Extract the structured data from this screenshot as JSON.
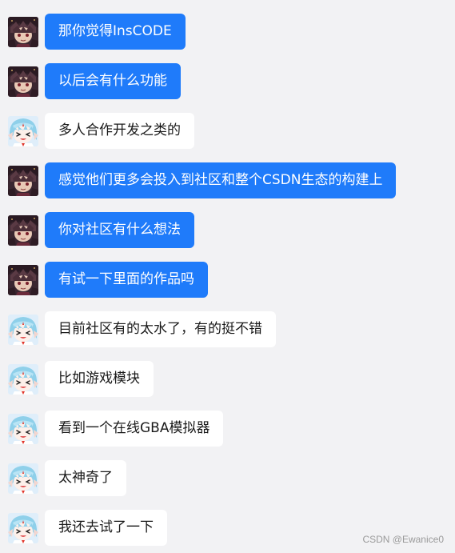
{
  "conversation": {
    "messages": [
      {
        "sender": "dark",
        "text": "那你觉得InsCODE"
      },
      {
        "sender": "dark",
        "text": "以后会有什么功能"
      },
      {
        "sender": "light",
        "text": "多人合作开发之类的"
      },
      {
        "sender": "dark",
        "text": "感觉他们更多会投入到社区和整个CSDN生态的构建上"
      },
      {
        "sender": "dark",
        "text": "你对社区有什么想法"
      },
      {
        "sender": "dark",
        "text": "有试一下里面的作品吗"
      },
      {
        "sender": "light",
        "text": "目前社区有的太水了，有的挺不错"
      },
      {
        "sender": "light",
        "text": "比如游戏模块"
      },
      {
        "sender": "light",
        "text": "看到一个在线GBA模拟器"
      },
      {
        "sender": "light",
        "text": "太神奇了"
      },
      {
        "sender": "light",
        "text": "我还去试了一下"
      }
    ]
  },
  "colors": {
    "page_background": "#f2f2f4",
    "dark_bubble": "#1f7bfa",
    "light_bubble": "#ffffff"
  },
  "watermark": "CSDN @Ewanice0"
}
